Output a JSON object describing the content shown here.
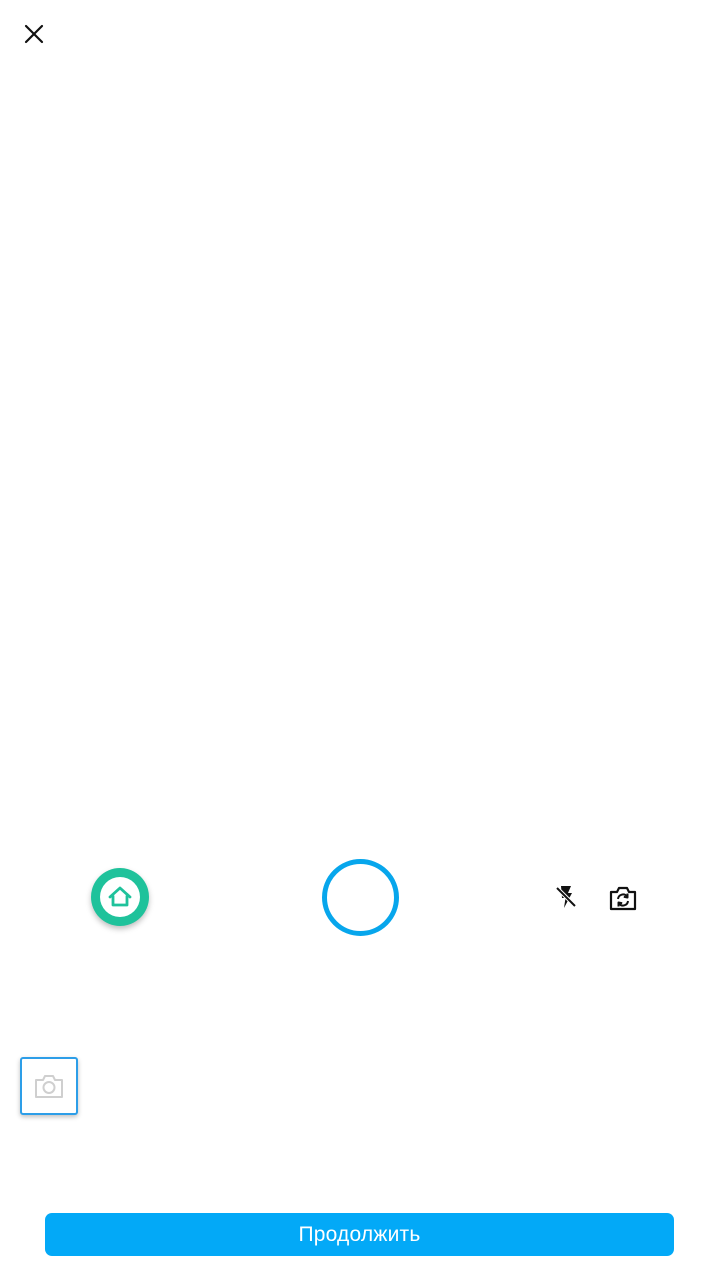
{
  "header": {
    "close_icon": "close-icon"
  },
  "controls": {
    "home_icon": "home-icon",
    "shutter": "shutter-button",
    "flash_icon": "flash-off-icon",
    "switch_camera_icon": "switch-camera-icon"
  },
  "gallery": {
    "thumbnail_icon": "camera-icon"
  },
  "footer": {
    "continue_label": "Продолжить"
  },
  "colors": {
    "accent": "#03a9f7",
    "shutter_ring": "#07a6ec",
    "home_button": "#1fc29b",
    "thumbnail_border": "#2d9ee8"
  }
}
